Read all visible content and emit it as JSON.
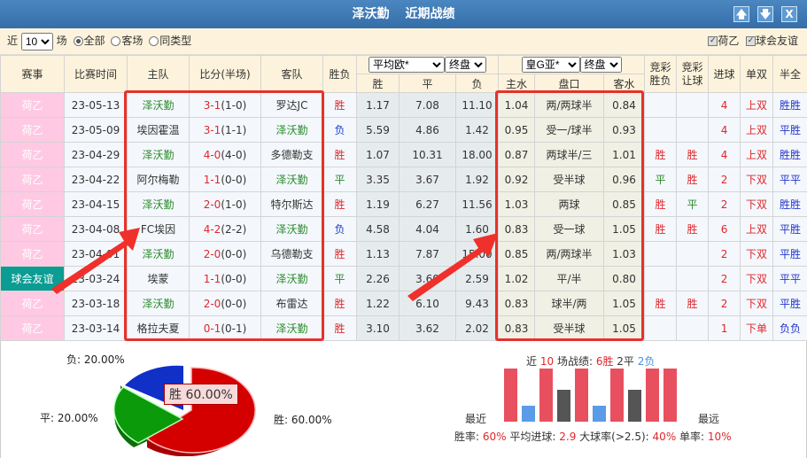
{
  "title": {
    "team": "泽沃勤",
    "label": "近期战绩"
  },
  "window_buttons": {
    "up": "🡅",
    "down": "🡇",
    "close": "X"
  },
  "filter": {
    "prefix": "近",
    "count": "10",
    "suffix": "场",
    "opt_all": "全部",
    "opt_away": "客场",
    "opt_same": "同类型",
    "chk1": "荷乙",
    "chk2": "球会友谊"
  },
  "headers": {
    "league": "赛事",
    "time": "比赛时间",
    "home": "主队",
    "score": "比分(半场)",
    "away": "客队",
    "result": "胜负",
    "eu_select": "平均欧*",
    "eu_stage": "终盘",
    "win": "胜",
    "draw": "平",
    "lose": "负",
    "ah_select": "皇G亚*",
    "ah_stage": "终盘",
    "home_w": "主水",
    "line": "盘口",
    "away_w": "客水",
    "jc_res": "竞彩胜负",
    "jc_hc": "竞彩让球",
    "goals": "进球",
    "oe": "单双",
    "htft": "半全"
  },
  "rows": [
    {
      "league": "荷乙",
      "time": "23-05-13",
      "home": "泽沃勤",
      "ft": "3-1",
      "ht": "(1-0)",
      "away": "罗达JC",
      "res": "胜",
      "w": "1.17",
      "d": "7.08",
      "l": "11.10",
      "hw": "1.04",
      "line": "两/两球半",
      "aw": "0.84",
      "jr": "",
      "jh": "",
      "goals": "4",
      "oe": "上双",
      "hf": "胜胜"
    },
    {
      "league": "荷乙",
      "time": "23-05-09",
      "home": "埃因霍温",
      "ft": "3-1",
      "ht": "(1-1)",
      "away": "泽沃勤",
      "res": "负",
      "w": "5.59",
      "d": "4.86",
      "l": "1.42",
      "hw": "0.95",
      "line": "受一/球半",
      "aw": "0.93",
      "jr": "",
      "jh": "",
      "goals": "4",
      "oe": "上双",
      "hf": "平胜"
    },
    {
      "league": "荷乙",
      "time": "23-04-29",
      "home": "泽沃勤",
      "ft": "4-0",
      "ht": "(4-0)",
      "away": "多德勒支",
      "res": "胜",
      "w": "1.07",
      "d": "10.31",
      "l": "18.00",
      "hw": "0.87",
      "line": "两球半/三",
      "aw": "1.01",
      "jr": "胜",
      "jh": "胜",
      "goals": "4",
      "oe": "上双",
      "hf": "胜胜"
    },
    {
      "league": "荷乙",
      "time": "23-04-22",
      "home": "阿尔梅勒",
      "ft": "1-1",
      "ht": "(0-0)",
      "away": "泽沃勤",
      "res": "平",
      "w": "3.35",
      "d": "3.67",
      "l": "1.92",
      "hw": "0.92",
      "line": "受半球",
      "aw": "0.96",
      "jr": "平",
      "jh": "胜",
      "goals": "2",
      "oe": "下双",
      "hf": "平平"
    },
    {
      "league": "荷乙",
      "time": "23-04-15",
      "home": "泽沃勤",
      "ft": "2-0",
      "ht": "(1-0)",
      "away": "特尔斯达",
      "res": "胜",
      "w": "1.19",
      "d": "6.27",
      "l": "11.56",
      "hw": "1.03",
      "line": "两球",
      "aw": "0.85",
      "jr": "胜",
      "jh": "平",
      "goals": "2",
      "oe": "下双",
      "hf": "胜胜"
    },
    {
      "league": "荷乙",
      "time": "23-04-08",
      "home": "FC埃因",
      "ft": "4-2",
      "ht": "(2-2)",
      "away": "泽沃勤",
      "res": "负",
      "w": "4.58",
      "d": "4.04",
      "l": "1.60",
      "hw": "0.83",
      "line": "受一球",
      "aw": "1.05",
      "jr": "胜",
      "jh": "胜",
      "goals": "6",
      "oe": "上双",
      "hf": "平胜"
    },
    {
      "league": "荷乙",
      "time": "23-04-01",
      "home": "泽沃勤",
      "ft": "2-0",
      "ht": "(0-0)",
      "away": "乌德勒支",
      "res": "胜",
      "w": "1.13",
      "d": "7.87",
      "l": "15.00",
      "hw": "0.85",
      "line": "两/两球半",
      "aw": "1.03",
      "jr": "",
      "jh": "",
      "goals": "2",
      "oe": "下双",
      "hf": "平胜"
    },
    {
      "league": "球会友谊",
      "time": "23-03-24",
      "home": "埃蒙",
      "ft": "1-1",
      "ht": "(0-0)",
      "away": "泽沃勤",
      "res": "平",
      "w": "2.26",
      "d": "3.60",
      "l": "2.59",
      "hw": "1.02",
      "line": "平/半",
      "aw": "0.80",
      "jr": "",
      "jh": "",
      "goals": "2",
      "oe": "下双",
      "hf": "平平"
    },
    {
      "league": "荷乙",
      "time": "23-03-18",
      "home": "泽沃勤",
      "ft": "2-0",
      "ht": "(0-0)",
      "away": "布雷达",
      "res": "胜",
      "w": "1.22",
      "d": "6.10",
      "l": "9.43",
      "hw": "0.83",
      "line": "球半/两",
      "aw": "1.05",
      "jr": "胜",
      "jh": "胜",
      "goals": "2",
      "oe": "下双",
      "hf": "平胜"
    },
    {
      "league": "荷乙",
      "time": "23-03-14",
      "home": "格拉夫夏",
      "ft": "0-1",
      "ht": "(0-1)",
      "away": "泽沃勤",
      "res": "胜",
      "w": "3.10",
      "d": "3.62",
      "l": "2.02",
      "hw": "0.83",
      "line": "受半球",
      "aw": "1.05",
      "jr": "",
      "jh": "",
      "goals": "1",
      "oe": "下单",
      "hf": "负负"
    }
  ],
  "pie": {
    "lose_label": "负: 20.00%",
    "draw_label": "平: 20.00%",
    "win_label": "胜: 60.00%",
    "tooltip": "胜 60.00%",
    "values": {
      "win": 60,
      "draw": 20,
      "lose": 20
    },
    "colors": {
      "win": "#d40000",
      "draw": "#0a9a0a",
      "lose": "#1030c8"
    }
  },
  "summary": {
    "p1": "近",
    "n": "10",
    "p2": "场战绩:",
    "w": "6胜",
    "d": "2平",
    "l": "2负",
    "recent": "最近",
    "oldest": "最远",
    "win_rate_lbl": "胜率:",
    "win_rate": "60%",
    "avg_lbl": "平均进球:",
    "avg": "2.9",
    "big_lbl": "大球率(>2.5):",
    "big": "40%",
    "odd_lbl": "单率:",
    "odd": "10%"
  },
  "result_bars": [
    "W",
    "L",
    "W",
    "D",
    "W",
    "L",
    "W",
    "D",
    "W",
    "W"
  ]
}
